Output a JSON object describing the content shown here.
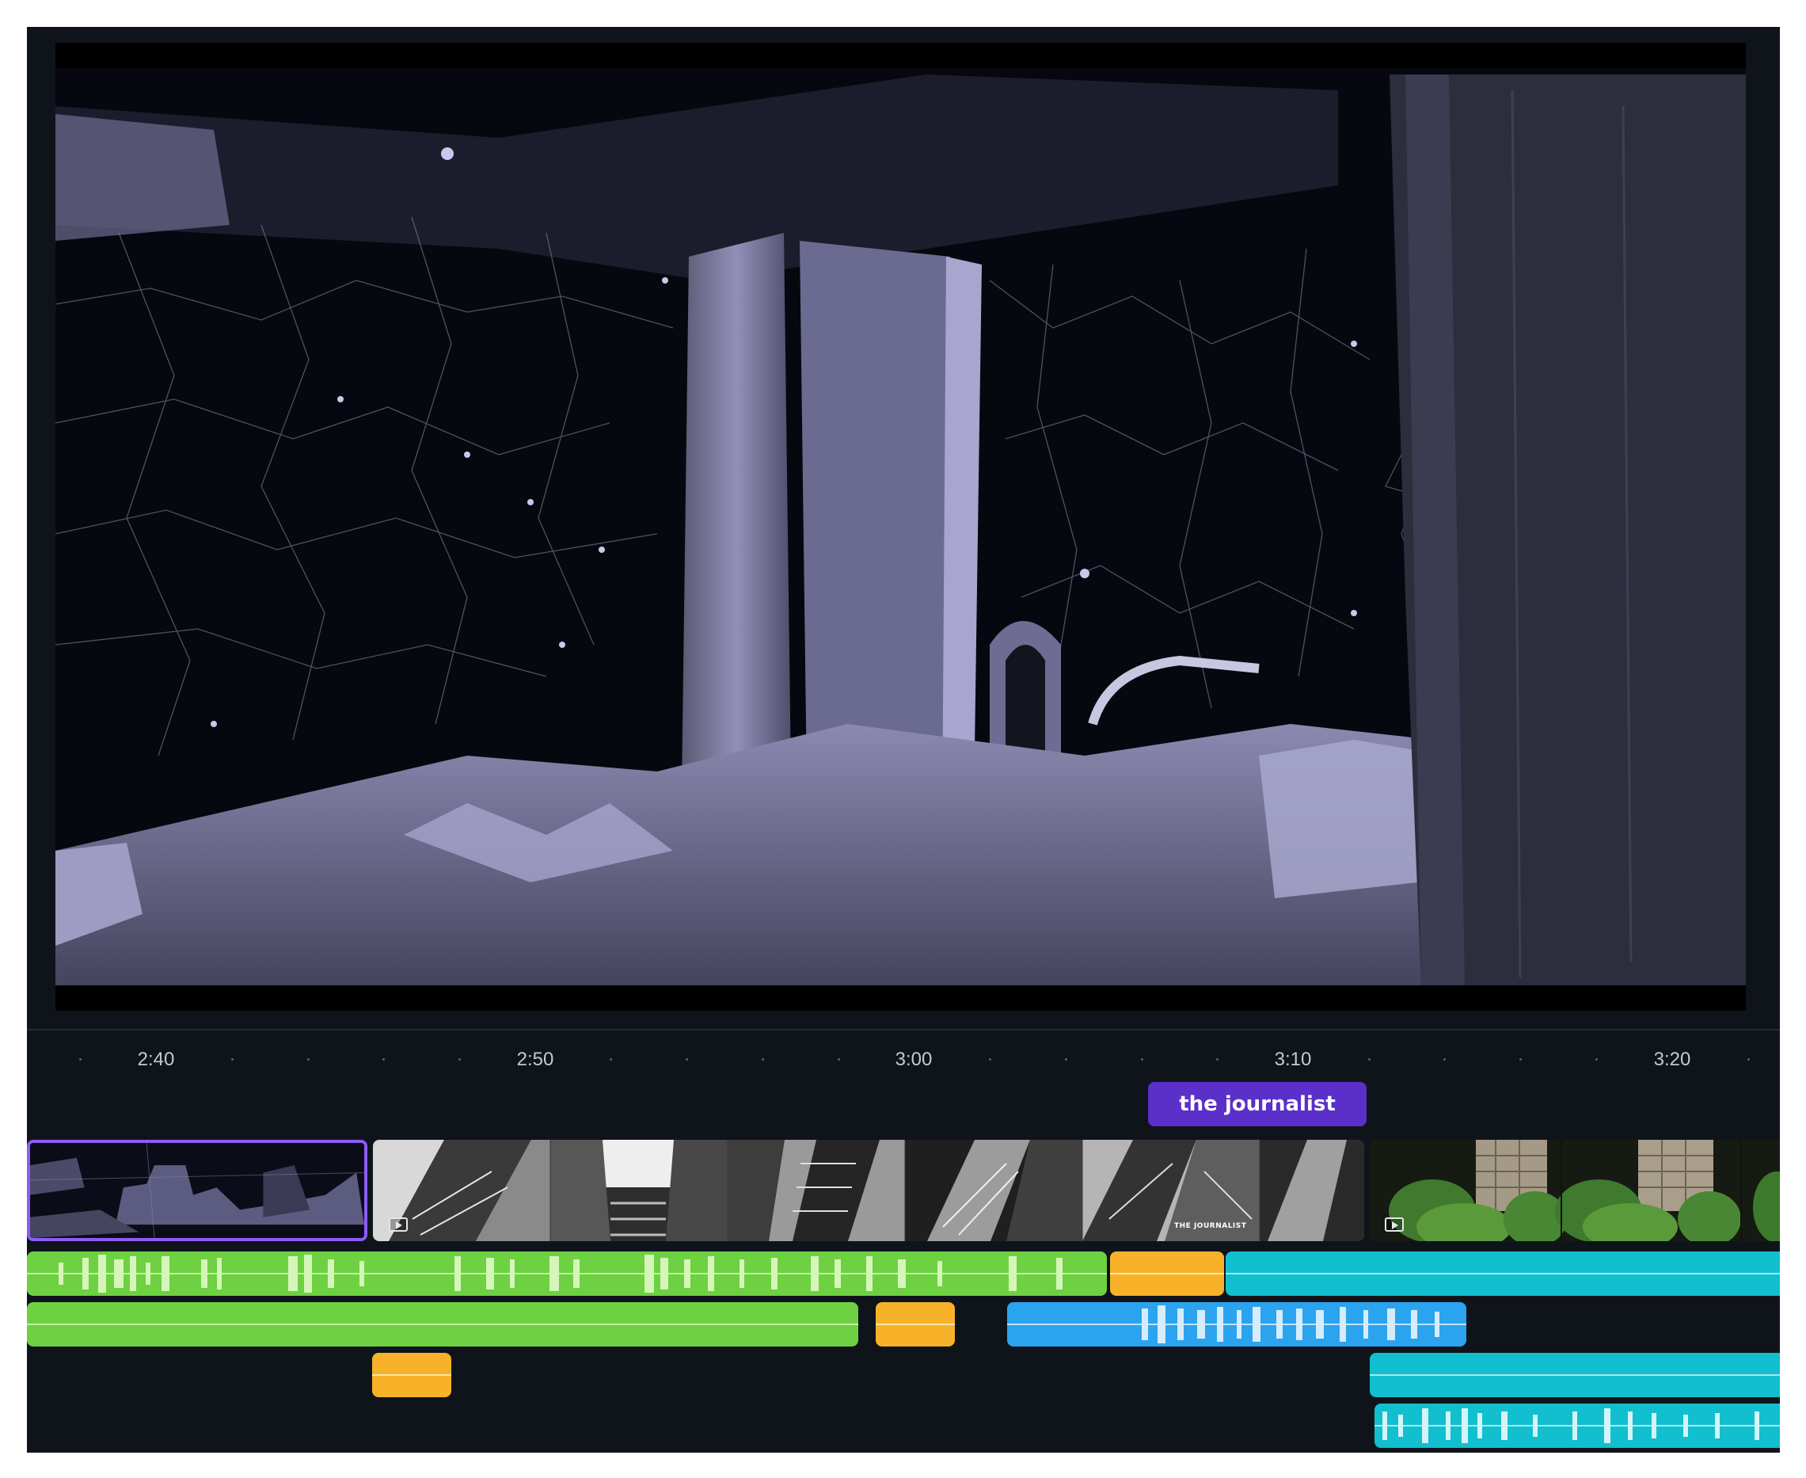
{
  "preview": {
    "scene": "wireframe-scan-interior"
  },
  "ruler": {
    "labels": [
      "2:40",
      "2:50",
      "3:00",
      "3:10",
      "3:20"
    ]
  },
  "marker": {
    "label": "the journalist"
  },
  "video_track": {
    "clips": [
      {
        "name": "dark-wireframe-clip",
        "selected": true
      },
      {
        "name": "buildings-clip",
        "overlay_text": "THE JOURNALIST"
      },
      {
        "name": "tower-trees-clip"
      }
    ]
  },
  "audio_tracks": {
    "colors": {
      "green": "#6dd142",
      "orange": "#f7b22a",
      "cyan": "#11bfcf",
      "blue": "#2ba4ef",
      "marker": "#5b2fc9",
      "selection": "#8b5cf6"
    }
  }
}
